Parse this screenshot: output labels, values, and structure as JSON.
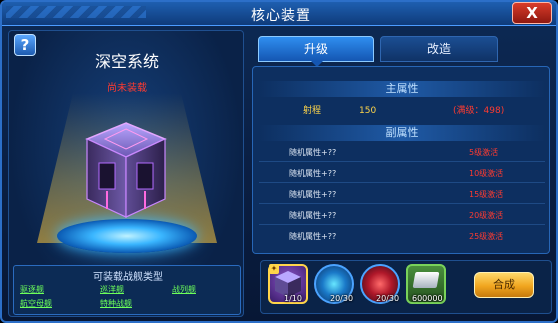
{
  "window": {
    "title": "核心装置",
    "close_label": "X"
  },
  "left": {
    "help_label": "?",
    "item_name": "深空系统",
    "equip_status": "尚未装载",
    "ship_types": {
      "title": "可装载战舰类型",
      "links": [
        "驱逐舰",
        "巡洋舰",
        "战列舰",
        "航空母舰",
        "特种战舰"
      ]
    }
  },
  "tabs": [
    {
      "label": "升级",
      "active": true
    },
    {
      "label": "改造",
      "active": false
    }
  ],
  "attributes": {
    "main_title": "主属性",
    "main": {
      "key": "射程",
      "value": "150",
      "max": "(满级：498)"
    },
    "sub_title": "副属性",
    "sub": [
      {
        "key": "随机属性+??",
        "requirement": "5级激活"
      },
      {
        "key": "随机属性+??",
        "requirement": "10级激活"
      },
      {
        "key": "随机属性+??",
        "requirement": "15级激活"
      },
      {
        "key": "随机属性+??",
        "requirement": "20级激活"
      },
      {
        "key": "随机属性+??",
        "requirement": "25级激活"
      }
    ]
  },
  "materials": [
    {
      "icon": "core-module-icon",
      "count": "1/10"
    },
    {
      "icon": "blue-energy-orb-icon",
      "count": "20/30"
    },
    {
      "icon": "red-energy-orb-icon",
      "count": "20/30"
    },
    {
      "icon": "silver-bar-icon",
      "count": "600000"
    }
  ],
  "compose_label": "合成",
  "colors": {
    "accent_blue": "#2f8ef0",
    "warning_red": "#ff3b30",
    "gold": "#ffd54a",
    "link_green": "#6dff5a"
  }
}
